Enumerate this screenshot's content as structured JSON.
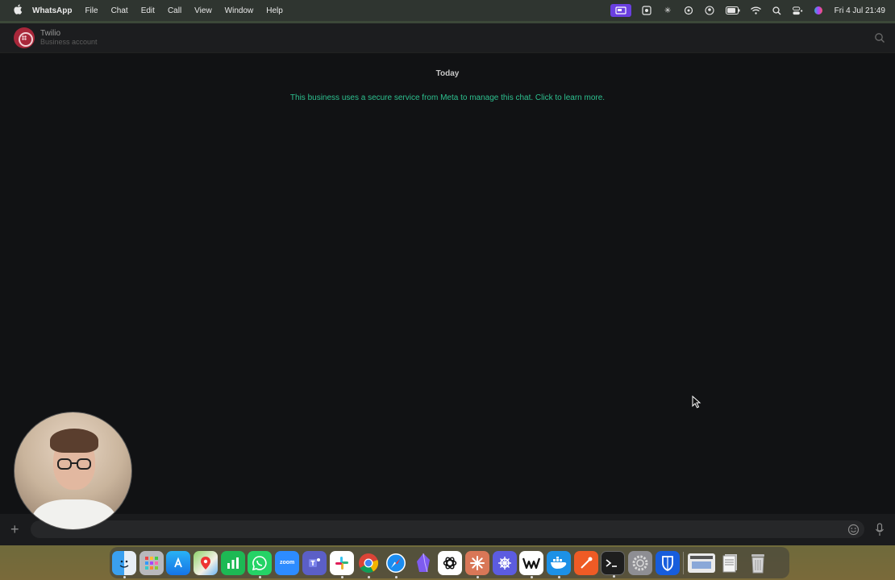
{
  "menubar": {
    "apple_icon": "apple-icon",
    "app_name": "WhatsApp",
    "menus": [
      "File",
      "Chat",
      "Edit",
      "Call",
      "View",
      "Window",
      "Help"
    ],
    "status_icons": [
      "screen-recording-icon",
      "app-menu-icon",
      "sparkle-icon",
      "openai-icon",
      "user-circle-icon",
      "battery-icon",
      "wifi-icon",
      "search-icon",
      "control-center-icon",
      "siri-icon"
    ],
    "clock": "Fri 4 Jul  21:49"
  },
  "chat": {
    "contact_name": "Twilio",
    "contact_subtitle": "Business account",
    "date_label": "Today",
    "notice": "This business uses a secure service from Meta to manage this chat. Click to learn more.",
    "composer_placeholder": ""
  },
  "colors": {
    "notice_text": "#2dc08f",
    "avatar_bg": "#a8273a",
    "window_bg": "#111214"
  },
  "dock": {
    "apps": [
      {
        "name": "Finder",
        "icon": "finder-icon",
        "running": true
      },
      {
        "name": "Launchpad",
        "icon": "launchpad-icon",
        "running": false
      },
      {
        "name": "App Store",
        "icon": "app-store-icon",
        "running": false
      },
      {
        "name": "Maps",
        "icon": "maps-icon",
        "running": false
      },
      {
        "name": "Numbers",
        "icon": "numbers-icon",
        "running": false
      },
      {
        "name": "WhatsApp",
        "icon": "whatsapp-icon",
        "running": true
      },
      {
        "name": "Zoom",
        "icon": "zoom-icon",
        "label": "zoom",
        "running": false
      },
      {
        "name": "Teams",
        "icon": "teams-icon",
        "running": false
      },
      {
        "name": "Slack",
        "icon": "slack-icon",
        "running": true
      },
      {
        "name": "Chrome",
        "icon": "chrome-icon",
        "running": true
      },
      {
        "name": "Safari",
        "icon": "safari-icon",
        "running": true
      },
      {
        "name": "Obsidian",
        "icon": "obsidian-icon",
        "running": false
      },
      {
        "name": "ChatGPT",
        "icon": "chatgpt-icon",
        "running": false
      },
      {
        "name": "Claude",
        "icon": "claude-icon",
        "running": true
      },
      {
        "name": "Perplexity",
        "icon": "perplexity-icon",
        "running": false
      },
      {
        "name": "Warp",
        "icon": "warp-icon",
        "running": true
      },
      {
        "name": "Docker",
        "icon": "docker-icon",
        "running": true
      },
      {
        "name": "Postman",
        "icon": "postman-icon",
        "running": false
      },
      {
        "name": "Terminal",
        "icon": "terminal-icon",
        "running": true
      },
      {
        "name": "System Settings",
        "icon": "settings-icon",
        "running": false
      },
      {
        "name": "Bitwarden",
        "icon": "bitwarden-icon",
        "running": false
      }
    ],
    "extras": [
      {
        "name": "Screenshot",
        "icon": "screenshot-thumbnail-icon"
      },
      {
        "name": "Documents",
        "icon": "documents-stack-icon"
      },
      {
        "name": "Trash",
        "icon": "trash-icon"
      }
    ]
  }
}
